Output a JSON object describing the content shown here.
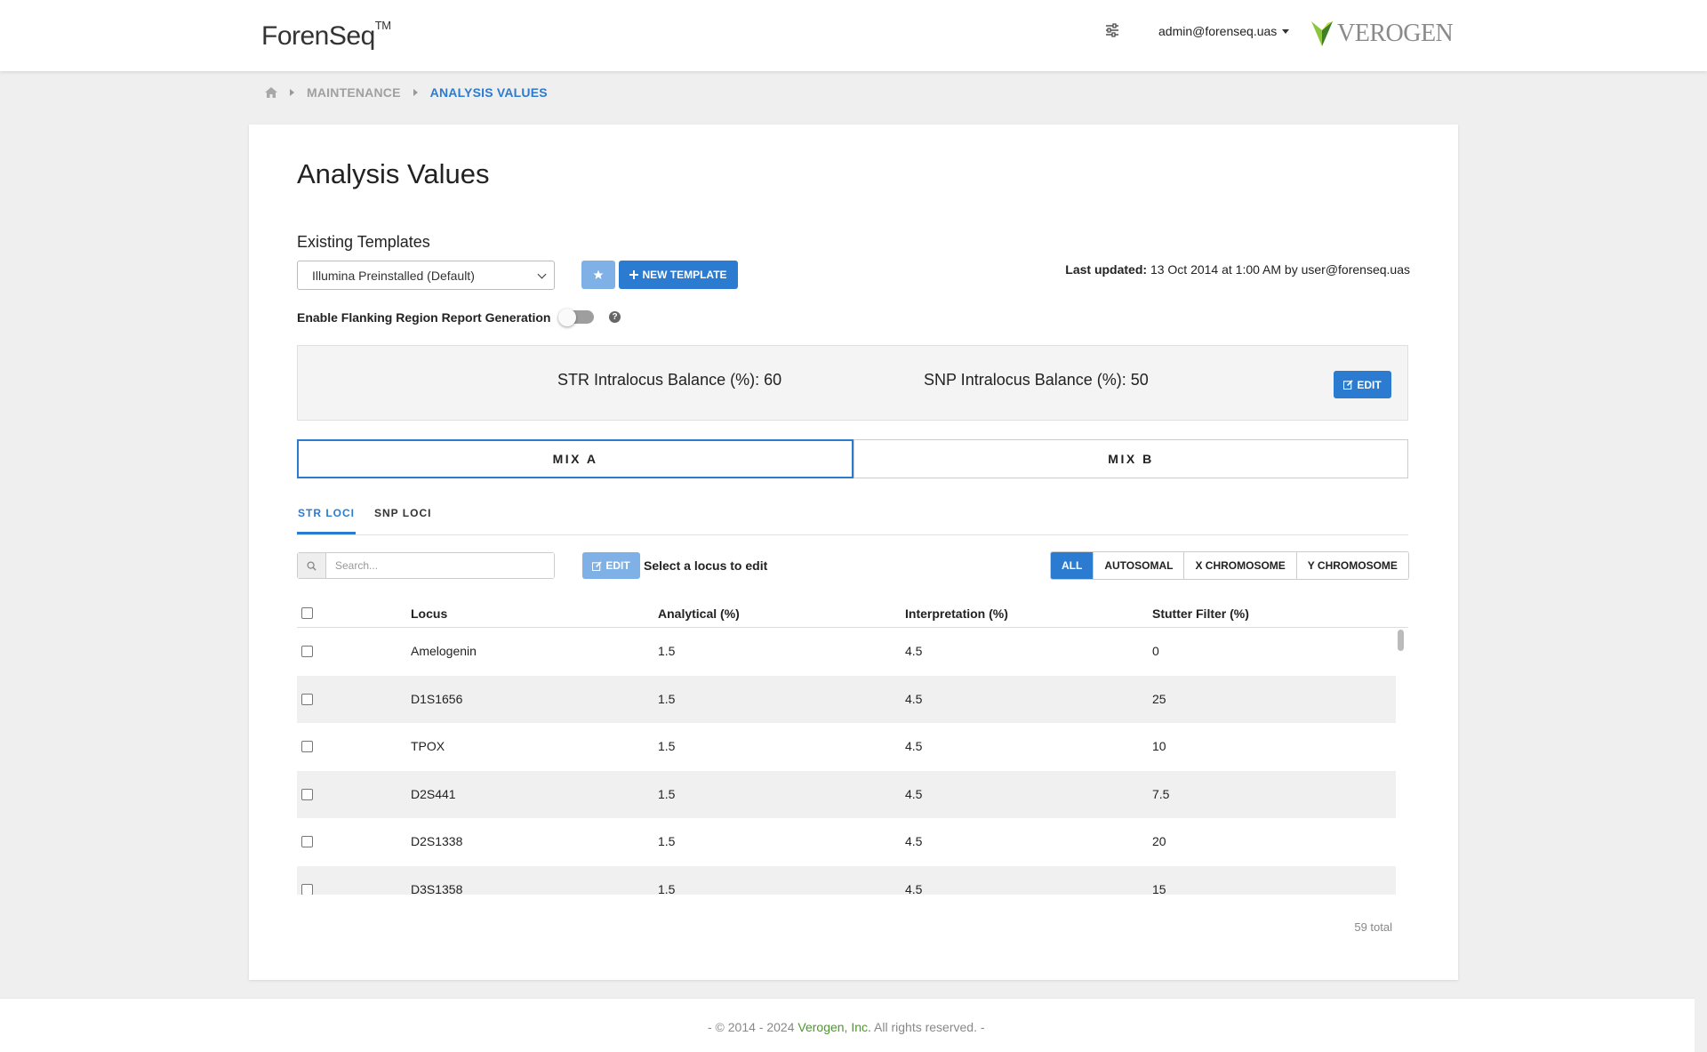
{
  "header": {
    "brand": "ForenSeq",
    "brand_mark": "TM",
    "user_email": "admin@forenseq.uas",
    "logo_text": "VEROGEN",
    "icons": {
      "settings": "sliders-icon",
      "logo": "verogen-leaf-icon"
    }
  },
  "breadcrumb": {
    "items": [
      "MAINTENANCE"
    ],
    "current": "ANALYSIS VALUES"
  },
  "page": {
    "title": "Analysis Values"
  },
  "templates": {
    "label": "Existing Templates",
    "selected": "Illumina Preinstalled (Default)",
    "new_template_label": "NEW TEMPLATE",
    "last_updated_label": "Last updated:",
    "last_updated_value": "13 Oct 2014 at 1:00 AM by user@forenseq.uas"
  },
  "flanking": {
    "label": "Enable Flanking Region Report Generation",
    "enabled": false
  },
  "balance": {
    "str": "STR Intralocus Balance (%): 60",
    "snp": "SNP Intralocus Balance (%): 50",
    "edit_label": "EDIT"
  },
  "mix_tabs": [
    {
      "label": "MIX A",
      "active": true
    },
    {
      "label": "MIX B",
      "active": false
    }
  ],
  "loci_tabs": [
    {
      "label": "STR LOCI",
      "active": true
    },
    {
      "label": "SNP LOCI",
      "active": false
    }
  ],
  "toolbar": {
    "search_placeholder": "Search...",
    "edit_label": "EDIT",
    "hint": "Select a locus to edit",
    "filters": [
      {
        "label": "ALL",
        "active": true
      },
      {
        "label": "AUTOSOMAL",
        "active": false
      },
      {
        "label": "X CHROMOSOME",
        "active": false
      },
      {
        "label": "Y CHROMOSOME",
        "active": false
      }
    ]
  },
  "table": {
    "columns": [
      "Locus",
      "Analytical (%)",
      "Interpretation (%)",
      "Stutter Filter (%)"
    ],
    "rows": [
      [
        "Amelogenin",
        "1.5",
        "4.5",
        "0"
      ],
      [
        "D1S1656",
        "1.5",
        "4.5",
        "25"
      ],
      [
        "TPOX",
        "1.5",
        "4.5",
        "10"
      ],
      [
        "D2S441",
        "1.5",
        "4.5",
        "7.5"
      ],
      [
        "D2S1338",
        "1.5",
        "4.5",
        "20"
      ],
      [
        "D3S1358",
        "1.5",
        "4.5",
        "15"
      ]
    ],
    "total": "59 total"
  },
  "footer": {
    "prefix": "- © 2014 - 2024 ",
    "company": "Verogen, Inc.",
    "suffix": " All rights reserved. -"
  },
  "colors": {
    "primary": "#2b7bd0",
    "primary_disabled": "#7fb0e6",
    "footer_link": "#4a9a28"
  }
}
